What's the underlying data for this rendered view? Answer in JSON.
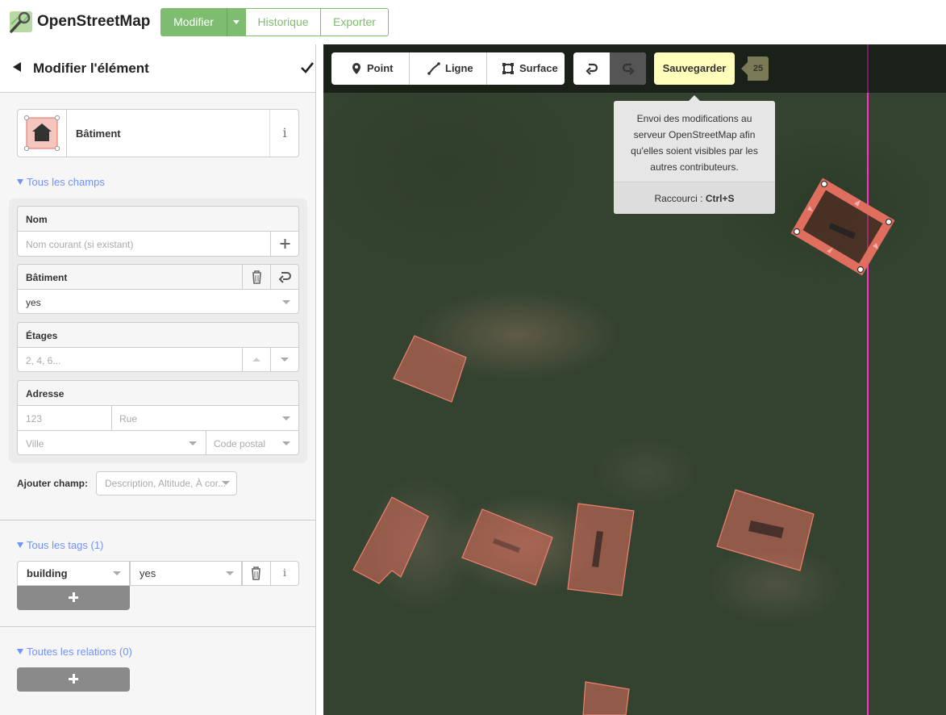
{
  "header": {
    "app_name": "OpenStreetMap",
    "nav": {
      "edit_label": "Modifier",
      "history_label": "Historique",
      "export_label": "Exporter"
    }
  },
  "sidebar": {
    "title": "Modifier l'élément",
    "preset": {
      "name": "Bâtiment",
      "info_glyph": "i"
    },
    "all_fields_label": "Tous les champs",
    "fields": {
      "name": {
        "label": "Nom",
        "placeholder": "Nom courant (si existant)"
      },
      "building": {
        "label": "Bâtiment",
        "value": "yes"
      },
      "levels": {
        "label": "Étages",
        "placeholder": "2, 4, 6..."
      },
      "address": {
        "label": "Adresse",
        "housenumber_placeholder": "123",
        "street_placeholder": "Rue",
        "city_placeholder": "Ville",
        "postcode_placeholder": "Code postal"
      }
    },
    "add_field": {
      "label": "Ajouter champ:",
      "placeholder": "Description, Altitude, À cor..."
    },
    "tags_label": "Tous les tags (1)",
    "tags": [
      {
        "key": "building",
        "value": "yes"
      }
    ],
    "relations_label": "Toutes les relations (0)"
  },
  "map": {
    "toolbar": {
      "point_label": "Point",
      "line_label": "Ligne",
      "area_label": "Surface",
      "save_label": "Sauvegarder",
      "edit_count": "25"
    },
    "tooltip": {
      "text": "Envoi des modifications au serveur OpenStreetMap afin qu'elles soient visibles par les autres contributeurs.",
      "shortcut_label": "Raccourci :",
      "shortcut_key": "Ctrl+S"
    },
    "colors": {
      "building_fill": "#e06e5f",
      "selected_outline": "#e06e5f",
      "boundary_line": "#ff33cc"
    }
  },
  "colors": {
    "brand_green": "#7ebc6f",
    "link_blue": "#7092ff",
    "save_yellow": "#ffffbb"
  }
}
